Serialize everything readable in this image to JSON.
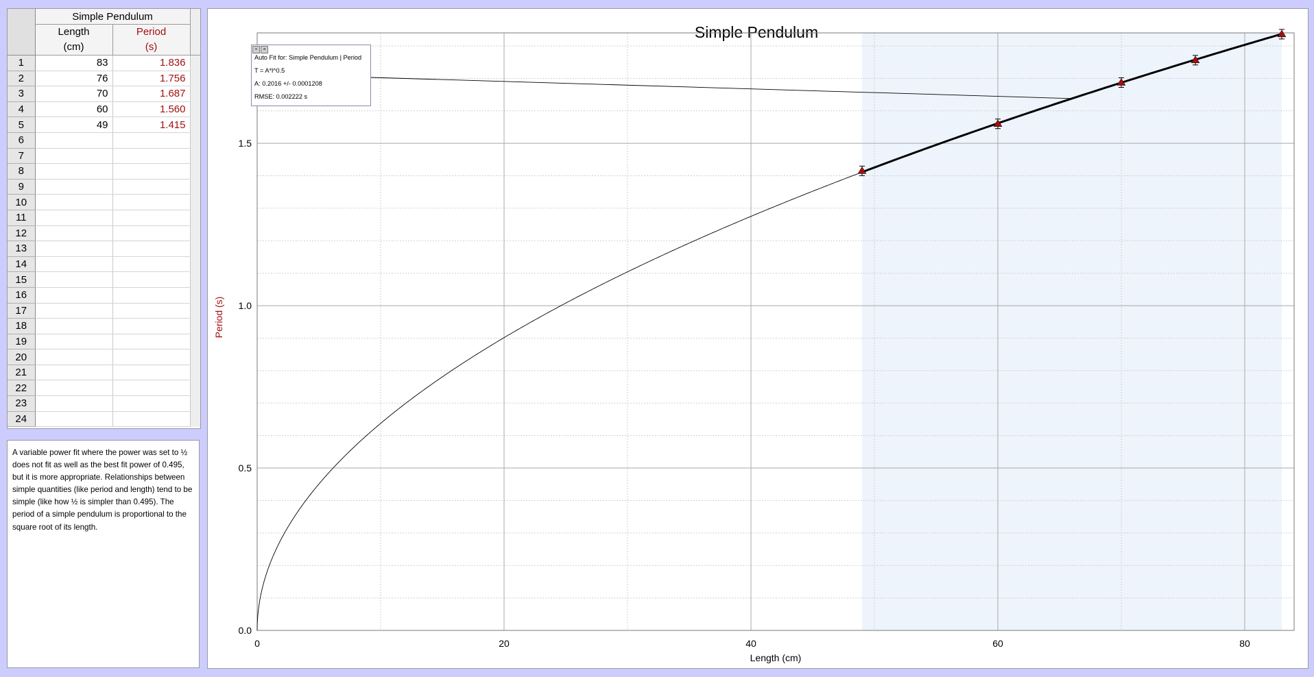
{
  "table": {
    "dataset_title": "Simple Pendulum",
    "columns": [
      {
        "name": "Length",
        "unit": "(cm)"
      },
      {
        "name": "Period",
        "unit": "(s)"
      }
    ],
    "rows": [
      [
        "83",
        "1.836"
      ],
      [
        "76",
        "1.756"
      ],
      [
        "70",
        "1.687"
      ],
      [
        "60",
        "1.560"
      ],
      [
        "49",
        "1.415"
      ]
    ],
    "row_numbers": [
      "1",
      "2",
      "3",
      "4",
      "5",
      "6",
      "7",
      "8",
      "9",
      "10",
      "11",
      "12",
      "13",
      "14",
      "15",
      "16",
      "17",
      "18",
      "19",
      "20",
      "21",
      "22",
      "23",
      "24"
    ]
  },
  "notes": {
    "text": "A variable power fit where the power was set to ½ does not fit as well as the best fit power of 0.495, but it is more appropriate. Relationships between simple quantities (like period and length) tend to be simple (like how ½ is simpler than 0.495). The period of a simple pendulum is proportional to the square root of its length."
  },
  "fit_box": {
    "controls": [
      "×",
      "≡"
    ],
    "line1": "Auto Fit for: Simple Pendulum | Period",
    "line2": "T = A*l^0.5",
    "line3": "A: 0.2016 +/- 0.0001208",
    "line4": "RMSE: 0.002222 s"
  },
  "colors": {
    "page_bg": "#ccccff",
    "data_color": "#a01010",
    "selection_bg": "#eef4fc"
  },
  "chart_data": {
    "type": "scatter",
    "title": "Simple Pendulum",
    "xlabel": "Length (cm)",
    "ylabel": "Period (s)",
    "xlim": [
      0,
      84
    ],
    "ylim": [
      0,
      1.84
    ],
    "x_ticks": [
      0,
      20,
      40,
      60,
      80
    ],
    "y_ticks": [
      0.0,
      0.5,
      1.0,
      1.5
    ],
    "x_tick_labels": [
      "0",
      "20",
      "40",
      "60",
      "80"
    ],
    "y_tick_labels": [
      "0.0",
      "0.5",
      "1.0",
      "1.5"
    ],
    "grid": true,
    "series": [
      {
        "name": "Period",
        "x": [
          83,
          76,
          70,
          60,
          49
        ],
        "y": [
          1.836,
          1.756,
          1.687,
          1.56,
          1.415
        ]
      }
    ],
    "fit": {
      "equation": "T = A*l^0.5",
      "A": 0.2016
    },
    "selected_range": [
      49,
      83
    ]
  }
}
